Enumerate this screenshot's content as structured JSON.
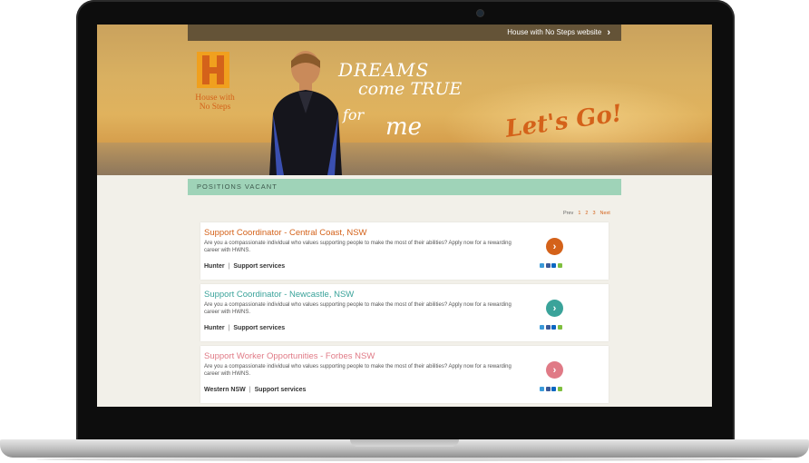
{
  "topbar": {
    "link_label": "House with No Steps website"
  },
  "logo": {
    "text": "House with No Steps"
  },
  "hero": {
    "slogan_line1": "DREAMS",
    "slogan_line2": "come TRUE",
    "slogan_line3": "for",
    "slogan_line4": "me",
    "cta": "Let's Go!"
  },
  "section": {
    "title": "POSITIONS VACANT"
  },
  "pagination": {
    "prev": "Prev",
    "pages": [
      "1",
      "2",
      "3"
    ],
    "next": "Next"
  },
  "jobs": [
    {
      "title": "Support Coordinator - Central Coast, NSW",
      "description": "Are you a compassionate individual who values supporting people to make the most of their abilities? Apply now for a rewarding career with HWNS.",
      "region": "Hunter",
      "category": "Support services",
      "color": "#d4621a"
    },
    {
      "title": "Support Coordinator - Newcastle, NSW",
      "description": "Are you a compassionate individual who values supporting people to make the most of their abilities? Apply now for a rewarding career with HWNS.",
      "region": "Hunter",
      "category": "Support services",
      "color": "#3aa39a"
    },
    {
      "title": "Support Worker Opportunities - Forbes NSW",
      "description": "Are you a compassionate individual who values supporting people to make the most of their abilities? Apply now for a rewarding career with HWNS.",
      "region": "Western NSW",
      "category": "Support services",
      "color": "#e07a86"
    }
  ],
  "separator": "|"
}
